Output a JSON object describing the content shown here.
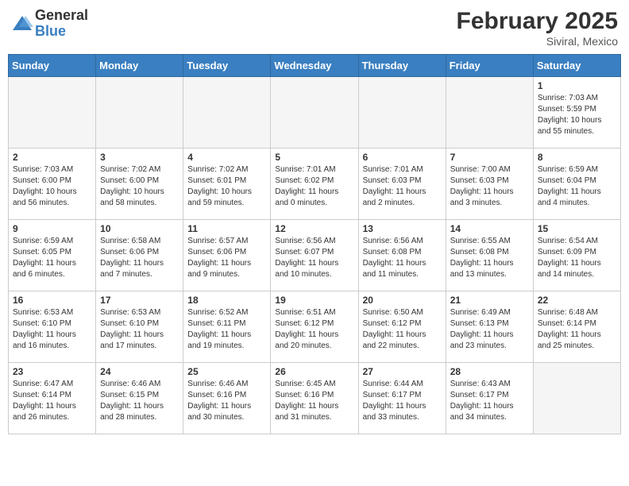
{
  "header": {
    "logo_general": "General",
    "logo_blue": "Blue",
    "month_title": "February 2025",
    "location": "Siviral, Mexico"
  },
  "weekdays": [
    "Sunday",
    "Monday",
    "Tuesday",
    "Wednesday",
    "Thursday",
    "Friday",
    "Saturday"
  ],
  "weeks": [
    [
      {
        "day": "",
        "empty": true
      },
      {
        "day": "",
        "empty": true
      },
      {
        "day": "",
        "empty": true
      },
      {
        "day": "",
        "empty": true
      },
      {
        "day": "",
        "empty": true
      },
      {
        "day": "",
        "empty": true
      },
      {
        "day": "1",
        "sunrise": "Sunrise: 7:03 AM",
        "sunset": "Sunset: 5:59 PM",
        "daylight": "Daylight: 10 hours and 55 minutes."
      }
    ],
    [
      {
        "day": "2",
        "sunrise": "Sunrise: 7:03 AM",
        "sunset": "Sunset: 6:00 PM",
        "daylight": "Daylight: 10 hours and 56 minutes."
      },
      {
        "day": "3",
        "sunrise": "Sunrise: 7:02 AM",
        "sunset": "Sunset: 6:00 PM",
        "daylight": "Daylight: 10 hours and 58 minutes."
      },
      {
        "day": "4",
        "sunrise": "Sunrise: 7:02 AM",
        "sunset": "Sunset: 6:01 PM",
        "daylight": "Daylight: 10 hours and 59 minutes."
      },
      {
        "day": "5",
        "sunrise": "Sunrise: 7:01 AM",
        "sunset": "Sunset: 6:02 PM",
        "daylight": "Daylight: 11 hours and 0 minutes."
      },
      {
        "day": "6",
        "sunrise": "Sunrise: 7:01 AM",
        "sunset": "Sunset: 6:03 PM",
        "daylight": "Daylight: 11 hours and 2 minutes."
      },
      {
        "day": "7",
        "sunrise": "Sunrise: 7:00 AM",
        "sunset": "Sunset: 6:03 PM",
        "daylight": "Daylight: 11 hours and 3 minutes."
      },
      {
        "day": "8",
        "sunrise": "Sunrise: 6:59 AM",
        "sunset": "Sunset: 6:04 PM",
        "daylight": "Daylight: 11 hours and 4 minutes."
      }
    ],
    [
      {
        "day": "9",
        "sunrise": "Sunrise: 6:59 AM",
        "sunset": "Sunset: 6:05 PM",
        "daylight": "Daylight: 11 hours and 6 minutes."
      },
      {
        "day": "10",
        "sunrise": "Sunrise: 6:58 AM",
        "sunset": "Sunset: 6:06 PM",
        "daylight": "Daylight: 11 hours and 7 minutes."
      },
      {
        "day": "11",
        "sunrise": "Sunrise: 6:57 AM",
        "sunset": "Sunset: 6:06 PM",
        "daylight": "Daylight: 11 hours and 9 minutes."
      },
      {
        "day": "12",
        "sunrise": "Sunrise: 6:56 AM",
        "sunset": "Sunset: 6:07 PM",
        "daylight": "Daylight: 11 hours and 10 minutes."
      },
      {
        "day": "13",
        "sunrise": "Sunrise: 6:56 AM",
        "sunset": "Sunset: 6:08 PM",
        "daylight": "Daylight: 11 hours and 11 minutes."
      },
      {
        "day": "14",
        "sunrise": "Sunrise: 6:55 AM",
        "sunset": "Sunset: 6:08 PM",
        "daylight": "Daylight: 11 hours and 13 minutes."
      },
      {
        "day": "15",
        "sunrise": "Sunrise: 6:54 AM",
        "sunset": "Sunset: 6:09 PM",
        "daylight": "Daylight: 11 hours and 14 minutes."
      }
    ],
    [
      {
        "day": "16",
        "sunrise": "Sunrise: 6:53 AM",
        "sunset": "Sunset: 6:10 PM",
        "daylight": "Daylight: 11 hours and 16 minutes."
      },
      {
        "day": "17",
        "sunrise": "Sunrise: 6:53 AM",
        "sunset": "Sunset: 6:10 PM",
        "daylight": "Daylight: 11 hours and 17 minutes."
      },
      {
        "day": "18",
        "sunrise": "Sunrise: 6:52 AM",
        "sunset": "Sunset: 6:11 PM",
        "daylight": "Daylight: 11 hours and 19 minutes."
      },
      {
        "day": "19",
        "sunrise": "Sunrise: 6:51 AM",
        "sunset": "Sunset: 6:12 PM",
        "daylight": "Daylight: 11 hours and 20 minutes."
      },
      {
        "day": "20",
        "sunrise": "Sunrise: 6:50 AM",
        "sunset": "Sunset: 6:12 PM",
        "daylight": "Daylight: 11 hours and 22 minutes."
      },
      {
        "day": "21",
        "sunrise": "Sunrise: 6:49 AM",
        "sunset": "Sunset: 6:13 PM",
        "daylight": "Daylight: 11 hours and 23 minutes."
      },
      {
        "day": "22",
        "sunrise": "Sunrise: 6:48 AM",
        "sunset": "Sunset: 6:14 PM",
        "daylight": "Daylight: 11 hours and 25 minutes."
      }
    ],
    [
      {
        "day": "23",
        "sunrise": "Sunrise: 6:47 AM",
        "sunset": "Sunset: 6:14 PM",
        "daylight": "Daylight: 11 hours and 26 minutes."
      },
      {
        "day": "24",
        "sunrise": "Sunrise: 6:46 AM",
        "sunset": "Sunset: 6:15 PM",
        "daylight": "Daylight: 11 hours and 28 minutes."
      },
      {
        "day": "25",
        "sunrise": "Sunrise: 6:46 AM",
        "sunset": "Sunset: 6:16 PM",
        "daylight": "Daylight: 11 hours and 30 minutes."
      },
      {
        "day": "26",
        "sunrise": "Sunrise: 6:45 AM",
        "sunset": "Sunset: 6:16 PM",
        "daylight": "Daylight: 11 hours and 31 minutes."
      },
      {
        "day": "27",
        "sunrise": "Sunrise: 6:44 AM",
        "sunset": "Sunset: 6:17 PM",
        "daylight": "Daylight: 11 hours and 33 minutes."
      },
      {
        "day": "28",
        "sunrise": "Sunrise: 6:43 AM",
        "sunset": "Sunset: 6:17 PM",
        "daylight": "Daylight: 11 hours and 34 minutes."
      },
      {
        "day": "",
        "empty": true
      }
    ]
  ]
}
